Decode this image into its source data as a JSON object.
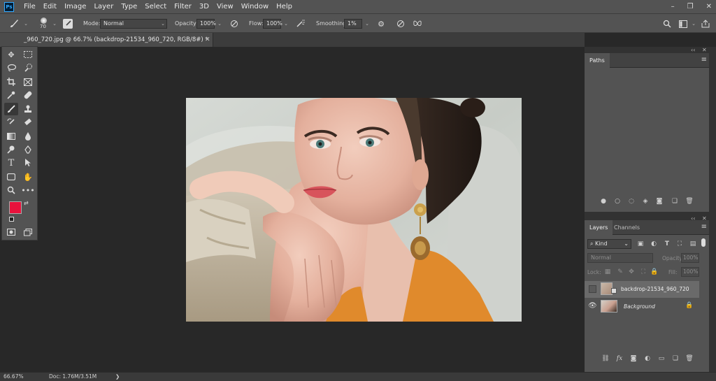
{
  "app": {
    "logo": "Ps"
  },
  "menu": [
    "File",
    "Edit",
    "Image",
    "Layer",
    "Type",
    "Select",
    "Filter",
    "3D",
    "View",
    "Window",
    "Help"
  ],
  "window_controls": {
    "minimize": "–",
    "restore": "❐",
    "close": "✕"
  },
  "options": {
    "brush_size": "70",
    "mode_label": "Mode:",
    "mode_value": "Normal",
    "opacity_label": "Opacity:",
    "opacity_value": "100%",
    "flow_label": "Flow:",
    "flow_value": "100%",
    "smoothing_label": "Smoothing:",
    "smoothing_value": "1%"
  },
  "document_tab": {
    "title": "_960_720.jpg @ 66.7% (backdrop-21534_960_720, RGB/8#) *",
    "close": "✕"
  },
  "colors": {
    "foreground": "#e8123c",
    "background": "#ffffff",
    "accent": "#31a8ff"
  },
  "paths_panel": {
    "tab": "Paths"
  },
  "layers_panel": {
    "tabs": [
      "Layers",
      "Channels"
    ],
    "kind_label": "Kind",
    "blend_mode": "Normal",
    "opacity_label": "Opacity:",
    "opacity_value": "100%",
    "lock_label": "Lock:",
    "fill_label": "Fill:",
    "fill_value": "100%",
    "layers": [
      {
        "name": "backdrop-21534_960_720",
        "visible": false,
        "locked": false,
        "selected": true
      },
      {
        "name": "Background",
        "visible": true,
        "locked": true,
        "selected": false
      }
    ]
  },
  "status": {
    "zoom": "66.67%",
    "doc": "Doc: 1.76M/3.51M",
    "arrow": "❯"
  }
}
